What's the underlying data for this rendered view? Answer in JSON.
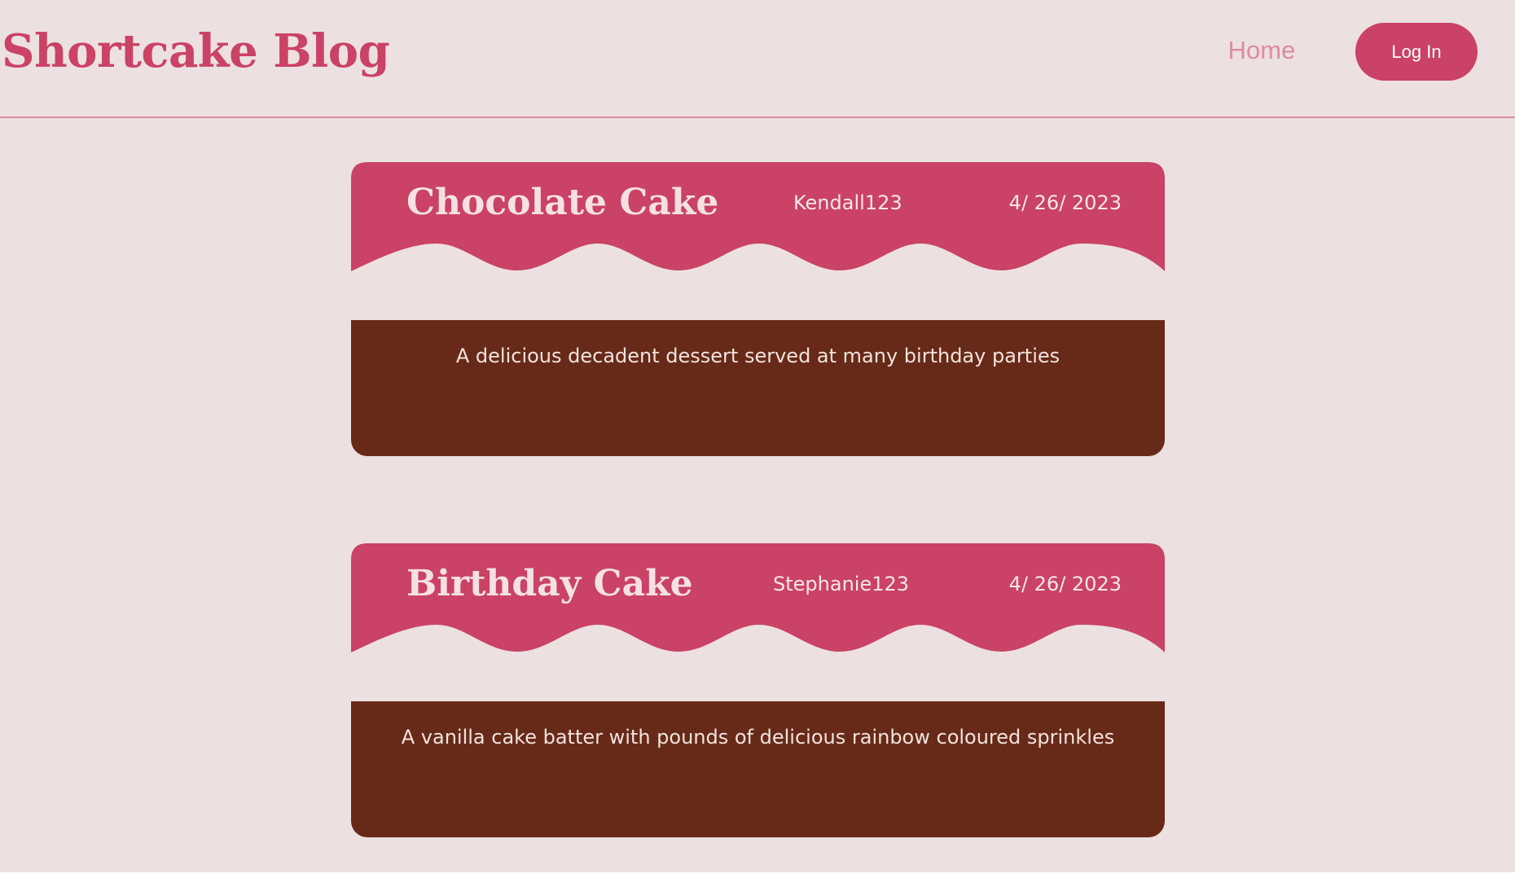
{
  "header": {
    "brand": "Shortcake Blog",
    "nav_home": "Home",
    "login_label": "Log In"
  },
  "posts": [
    {
      "title": "Chocolate Cake",
      "author": "Kendall123",
      "date": "4/ 26/ 2023",
      "description": "A delicious decadent dessert served at many birthday parties"
    },
    {
      "title": "Birthday Cake",
      "author": "Stephanie123",
      "date": "4/ 26/ 2023",
      "description": "A vanilla cake batter with pounds of delicious rainbow coloured sprinkles"
    }
  ],
  "colors": {
    "background": "#ece0e0",
    "accent_pink": "#ca4265",
    "nav_pink": "#de8ba2",
    "chocolate": "#672a18",
    "divider": "#d88a9b",
    "cream_text": "#f7e6e8"
  }
}
